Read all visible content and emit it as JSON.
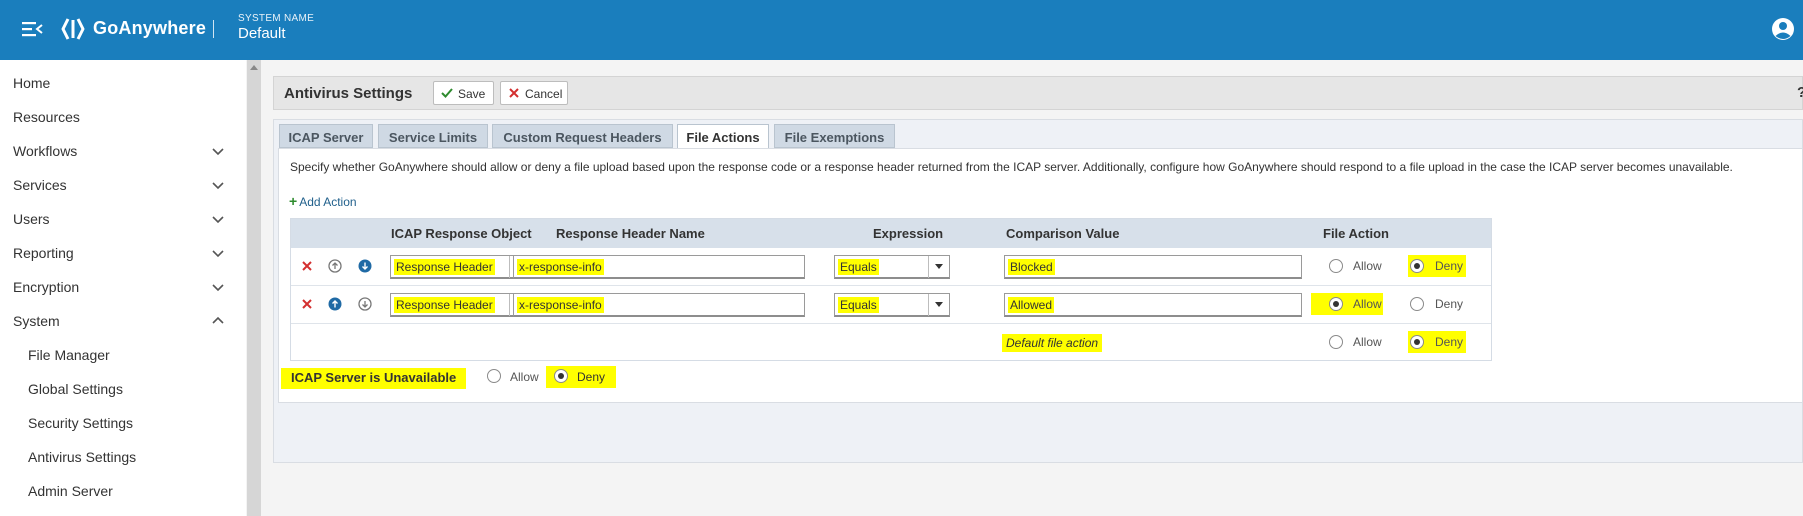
{
  "topbar": {
    "brand": "GoAnywhere",
    "system_label": "SYSTEM NAME",
    "system_value": "Default"
  },
  "sidebar": {
    "items": [
      {
        "label": "Home"
      },
      {
        "label": "Resources"
      },
      {
        "label": "Workflows"
      },
      {
        "label": "Services"
      },
      {
        "label": "Users"
      },
      {
        "label": "Reporting"
      },
      {
        "label": "Encryption"
      },
      {
        "label": "System"
      },
      {
        "label": "File Manager"
      },
      {
        "label": "Global Settings"
      },
      {
        "label": "Security Settings"
      },
      {
        "label": "Antivirus Settings"
      },
      {
        "label": "Admin Server"
      }
    ]
  },
  "panel": {
    "title": "Antivirus Settings",
    "save_label": "Save",
    "cancel_label": "Cancel",
    "help_label": "?"
  },
  "tabs": [
    {
      "label": "ICAP Server"
    },
    {
      "label": "Service Limits"
    },
    {
      "label": "Custom Request Headers"
    },
    {
      "label": "File Actions"
    },
    {
      "label": "File Exemptions"
    }
  ],
  "file_actions": {
    "description": "Specify whether GoAnywhere should allow or deny a file upload based upon the response code or a response header returned from the ICAP server. Additionally, configure how GoAnywhere should respond to a file upload in the case the ICAP server becomes unavailable.",
    "add_action_label": "Add Action",
    "columns": [
      "ICAP Response Object",
      "Response Header Name",
      "Expression",
      "Comparison Value",
      "File Action"
    ],
    "rows": [
      {
        "object": "Response Header",
        "header_name": "x-response-info",
        "expression": "Equals",
        "value": "Blocked",
        "allow_label": "Allow",
        "deny_label": "Deny",
        "selected": "Deny"
      },
      {
        "object": "Response Header",
        "header_name": "x-response-info",
        "expression": "Equals",
        "value": "Allowed",
        "allow_label": "Allow",
        "deny_label": "Deny",
        "selected": "Allow"
      }
    ],
    "default_row": {
      "label": "Default file action",
      "allow_label": "Allow",
      "deny_label": "Deny",
      "selected": "Deny"
    },
    "unavailable": {
      "label": "ICAP Server is Unavailable",
      "allow_label": "Allow",
      "deny_label": "Deny",
      "selected": "Deny"
    }
  }
}
